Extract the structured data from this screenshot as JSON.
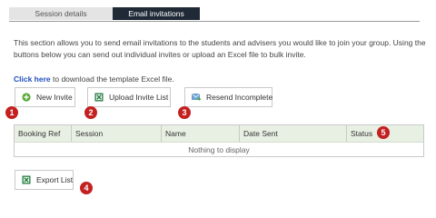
{
  "tabs": [
    {
      "label": "Session details"
    },
    {
      "label": "Email invitations"
    }
  ],
  "intro_text": "This section allows you to send email invitations to the students and advisers you would like to join your group. Using the buttons below you can send out individual invites or upload an Excel file to bulk invite.",
  "template": {
    "link_text": "Click here",
    "rest_text": " to download the template Excel file."
  },
  "buttons": {
    "new_invite": {
      "label": "New Invite",
      "icon": "plus-circle-icon"
    },
    "upload_invite_list": {
      "label": "Upload Invite List",
      "icon": "excel-icon"
    },
    "resend_incomplete": {
      "label": "Resend Incomplete",
      "icon": "email-send-icon"
    },
    "export_list": {
      "label": "Export List",
      "icon": "excel-icon"
    }
  },
  "table": {
    "columns": [
      "Booking Ref",
      "Session",
      "Name",
      "Date Sent",
      "Status"
    ],
    "empty_message": "Nothing to display"
  },
  "badges": [
    "1",
    "2",
    "3",
    "4",
    "5"
  ],
  "colors": {
    "badge": "#c42020",
    "active_tab": "#1f2a36",
    "link": "#1f4fbf",
    "table_header": "#e8f0e3",
    "excel_green": "#1e7a3c"
  }
}
